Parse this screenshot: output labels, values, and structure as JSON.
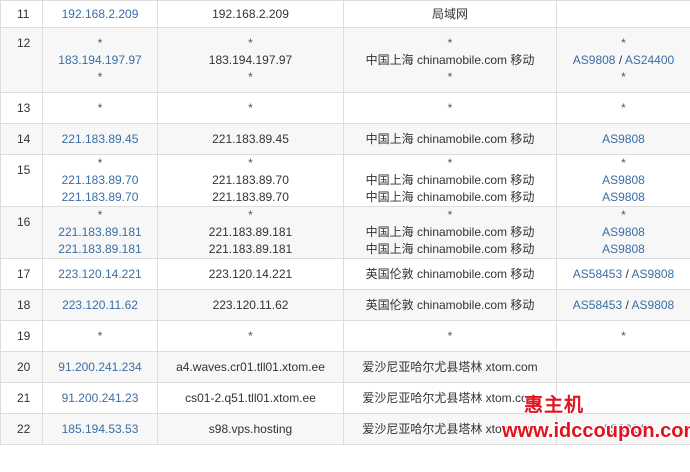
{
  "rows": [
    {
      "hop": "11",
      "ip": [
        "192.168.2.209"
      ],
      "host": [
        "192.168.2.209"
      ],
      "loc": [
        "局域网"
      ],
      "as": [
        []
      ]
    },
    {
      "hop": "12",
      "ip": [
        "*",
        "183.194.197.97",
        "*"
      ],
      "host": [
        "*",
        "183.194.197.97",
        "*"
      ],
      "loc": [
        "*",
        "中国上海 chinamobile.com 移动",
        "*"
      ],
      "as": [
        [
          "*"
        ],
        [
          "AS9808",
          "AS24400"
        ],
        [
          "*"
        ]
      ]
    },
    {
      "hop": "13",
      "ip": [
        "*"
      ],
      "host": [
        "*"
      ],
      "loc": [
        "*"
      ],
      "as": [
        [
          "*"
        ]
      ]
    },
    {
      "hop": "14",
      "ip": [
        "221.183.89.45"
      ],
      "host": [
        "221.183.89.45"
      ],
      "loc": [
        "中国上海 chinamobile.com 移动"
      ],
      "as": [
        [
          "AS9808"
        ]
      ]
    },
    {
      "hop": "15",
      "ip": [
        "*",
        "221.183.89.70",
        "221.183.89.70"
      ],
      "host": [
        "*",
        "221.183.89.70",
        "221.183.89.70"
      ],
      "loc": [
        "*",
        "中国上海 chinamobile.com 移动",
        "中国上海 chinamobile.com 移动"
      ],
      "as": [
        [
          "*"
        ],
        [
          "AS9808"
        ],
        [
          "AS9808"
        ]
      ]
    },
    {
      "hop": "16",
      "ip": [
        "*",
        "221.183.89.181",
        "221.183.89.181"
      ],
      "host": [
        "*",
        "221.183.89.181",
        "221.183.89.181"
      ],
      "loc": [
        "*",
        "中国上海 chinamobile.com 移动",
        "中国上海 chinamobile.com 移动"
      ],
      "as": [
        [
          "*"
        ],
        [
          "AS9808"
        ],
        [
          "AS9808"
        ]
      ]
    },
    {
      "hop": "17",
      "ip": [
        "223.120.14.221"
      ],
      "host": [
        "223.120.14.221"
      ],
      "loc": [
        "英国伦敦 chinamobile.com 移动"
      ],
      "as": [
        [
          "AS58453",
          "AS9808"
        ]
      ]
    },
    {
      "hop": "18",
      "ip": [
        "223.120.11.62"
      ],
      "host": [
        "223.120.11.62"
      ],
      "loc": [
        "英国伦敦 chinamobile.com 移动"
      ],
      "as": [
        [
          "AS58453",
          "AS9808"
        ]
      ]
    },
    {
      "hop": "19",
      "ip": [
        "*"
      ],
      "host": [
        "*"
      ],
      "loc": [
        "*"
      ],
      "as": [
        [
          "*"
        ]
      ]
    },
    {
      "hop": "20",
      "ip": [
        "91.200.241.234"
      ],
      "host": [
        "a4.waves.cr01.tll01.xtom.ee"
      ],
      "loc": [
        "爱沙尼亚哈尔尤县塔林 xtom.com"
      ],
      "as": [
        []
      ]
    },
    {
      "hop": "21",
      "ip": [
        "91.200.241.23"
      ],
      "host": [
        "cs01-2.q51.tll01.xtom.ee"
      ],
      "loc": [
        "爱沙尼亚哈尔尤县塔林 xtom.com"
      ],
      "as": [
        []
      ]
    },
    {
      "hop": "22",
      "ip": [
        "185.194.53.53"
      ],
      "host": [
        "s98.vps.hosting"
      ],
      "loc": [
        "爱沙尼亚哈尔尤县塔林 xtom.com"
      ],
      "as": [
        [
          "AS3214"
        ]
      ]
    }
  ],
  "watermark": {
    "title": "惠主机",
    "url": "www.idccoupon.com"
  },
  "colors": {
    "link": "#3a6ea5",
    "border": "#dddddd",
    "alt_row": "#f7f7f7",
    "watermark": "#e0141e"
  }
}
